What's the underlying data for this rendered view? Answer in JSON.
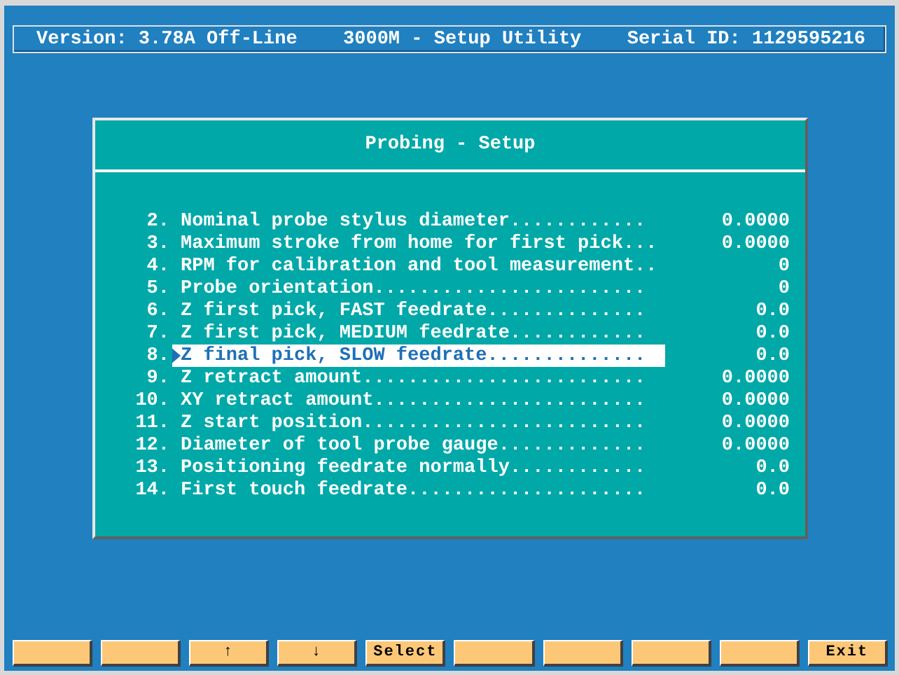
{
  "header": {
    "version": "Version: 3.78A Off-Line",
    "title": "3000M - Setup Utility",
    "serial": "Serial ID: 1129595216"
  },
  "dialog": {
    "title": "Probing - Setup",
    "rows": [
      {
        "number": "2.",
        "label": "Nominal probe stylus diameter............",
        "value": "0.0000",
        "selected": false
      },
      {
        "number": "3.",
        "label": "Maximum stroke from home for first pick...",
        "value": "0.0000",
        "selected": false
      },
      {
        "number": "4.",
        "label": "RPM for calibration and tool measurement..",
        "value": "0",
        "selected": false
      },
      {
        "number": "5.",
        "label": "Probe orientation........................",
        "value": "0",
        "selected": false
      },
      {
        "number": "6.",
        "label": "Z first pick, FAST feedrate..............",
        "value": "0.0",
        "selected": false
      },
      {
        "number": "7.",
        "label": "Z first pick, MEDIUM feedrate............",
        "value": "0.0",
        "selected": false
      },
      {
        "number": "8.",
        "label": "Z final pick, SLOW feedrate..............",
        "value": "0.0",
        "selected": true
      },
      {
        "number": "9.",
        "label": "Z retract amount.........................",
        "value": "0.0000",
        "selected": false
      },
      {
        "number": "10.",
        "label": "XY retract amount........................",
        "value": "0.0000",
        "selected": false
      },
      {
        "number": "11.",
        "label": "Z start position.........................",
        "value": "0.0000",
        "selected": false
      },
      {
        "number": "12.",
        "label": "Diameter of tool probe gauge.............",
        "value": "0.0000",
        "selected": false
      },
      {
        "number": "13.",
        "label": "Positioning feedrate normally............",
        "value": "0.0",
        "selected": false
      },
      {
        "number": "14.",
        "label": "First touch feedrate.....................",
        "value": "0.0",
        "selected": false
      }
    ]
  },
  "function_keys": [
    {
      "kind": "blank"
    },
    {
      "kind": "blank"
    },
    {
      "kind": "text",
      "label": "↑"
    },
    {
      "kind": "text",
      "label": "↓"
    },
    {
      "kind": "text",
      "label": "Select"
    },
    {
      "kind": "blank"
    },
    {
      "kind": "blank"
    },
    {
      "kind": "blank"
    },
    {
      "kind": "blank"
    },
    {
      "kind": "text",
      "label": "Exit"
    }
  ]
}
